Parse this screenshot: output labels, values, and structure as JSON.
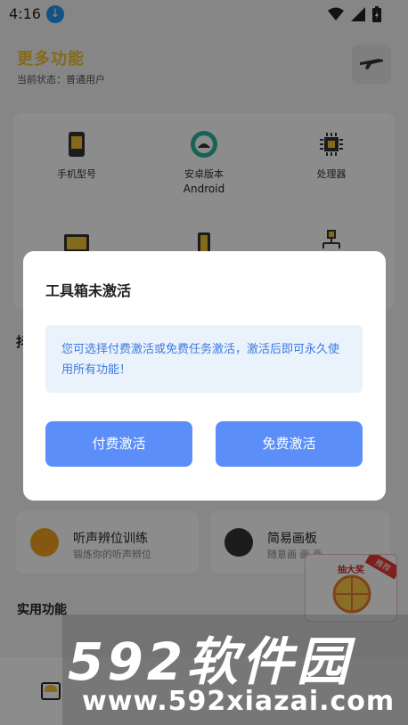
{
  "status_bar": {
    "time": "4:16"
  },
  "header": {
    "title": "更多功能",
    "subtitle": "当前状态：普通用户"
  },
  "grid": [
    {
      "label": "手机型号",
      "sub": ""
    },
    {
      "label": "安卓版本",
      "sub": "Android"
    },
    {
      "label": "处理器",
      "sub": ""
    }
  ],
  "side_letter": "抖",
  "tools": [
    {
      "title": "听声辨位训练",
      "desc": "锻炼你的听声辨位"
    },
    {
      "title": "简易画板",
      "desc": "随意画 画 画.."
    }
  ],
  "section_title": "实用功能",
  "lottery": {
    "badge": "推荐",
    "label": "抽大奖"
  },
  "dialog": {
    "title": "工具箱未激活",
    "message": "您可选择付费激活或免费任务激活，激活后即可永久使用所有功能！",
    "paid_label": "付费激活",
    "free_label": "免费激活"
  },
  "watermark": {
    "brand": "592软件园",
    "url": "www.592xiazai.com"
  },
  "colors": {
    "accent_yellow": "#f1c232",
    "button_blue": "#5b8ef9",
    "message_bg": "#eaf2fc",
    "message_text": "#3d7be0"
  }
}
